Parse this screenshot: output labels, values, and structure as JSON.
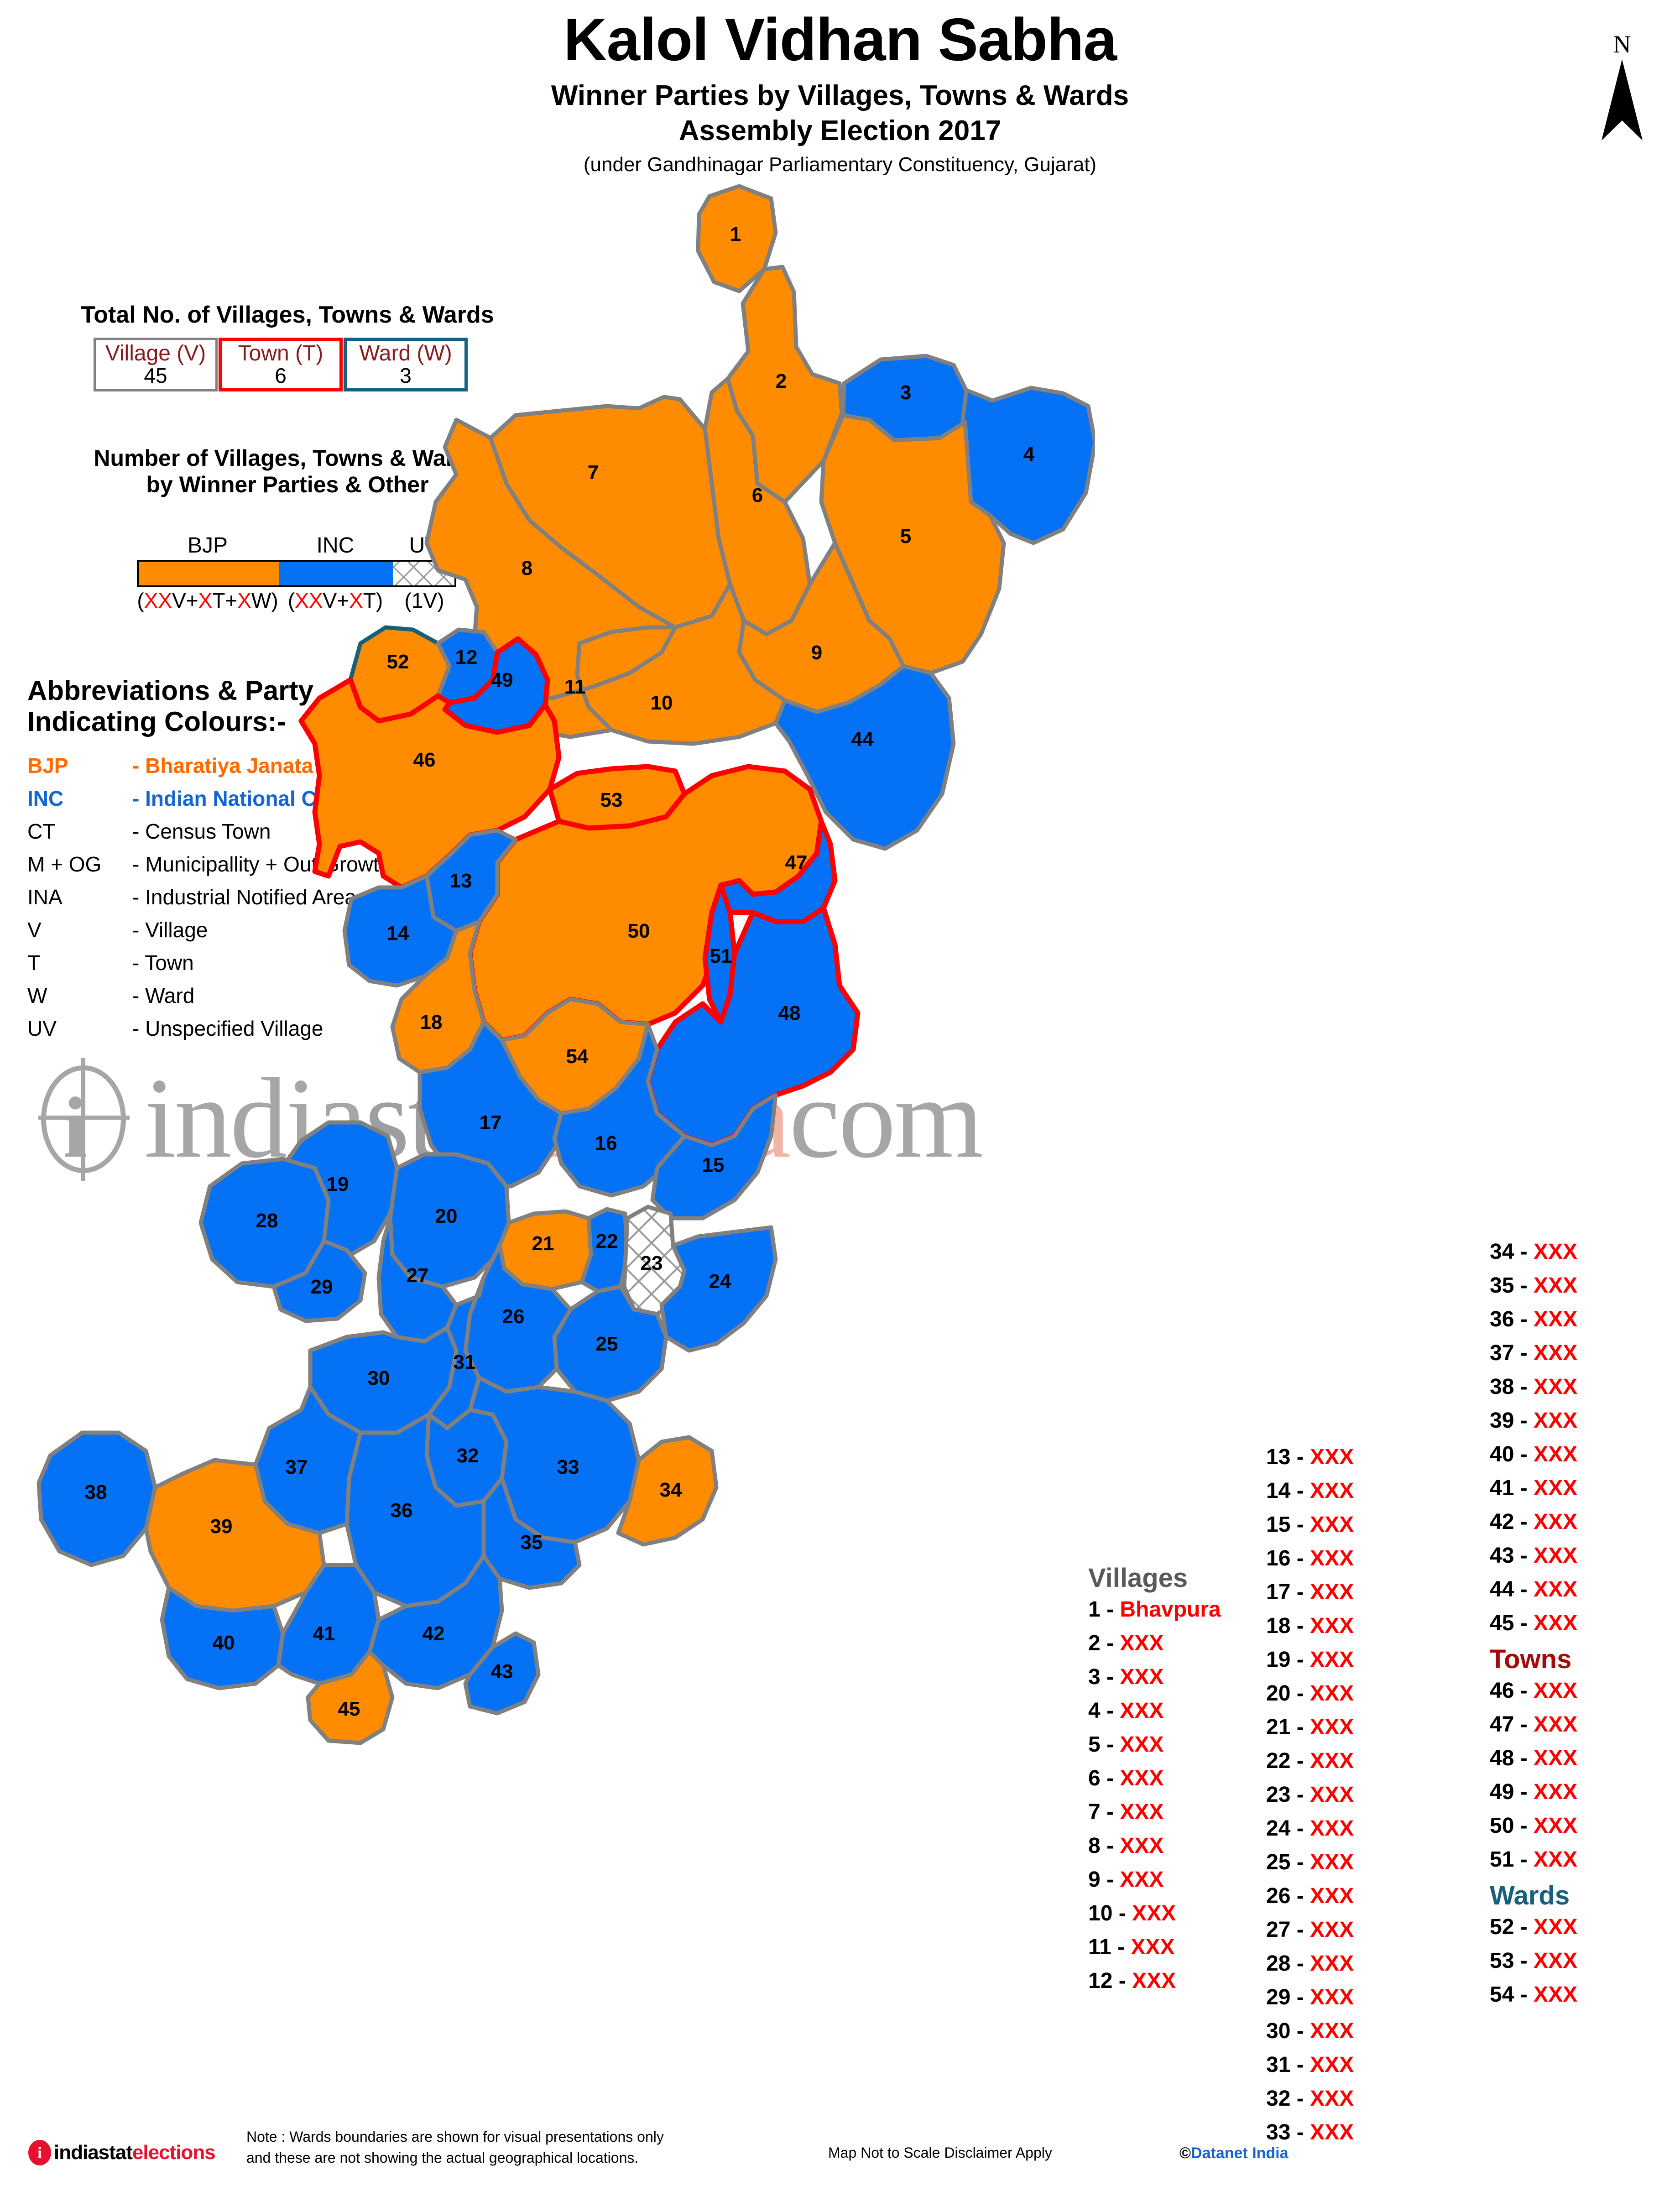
{
  "title": {
    "main": "Kalol Vidhan Sabha",
    "sub1": "Winner Parties by Villages, Towns & Wards",
    "sub2": "Assembly Election 2017",
    "sub3": "(under Gandhinagar Parliamentary Constituency, Gujarat)"
  },
  "north": {
    "label": "N"
  },
  "totals": {
    "heading": "Total No. of Villages, Towns & Wards",
    "boxes": [
      {
        "label": "Village (V)",
        "value": "45",
        "border": "#808080"
      },
      {
        "label": "Town (T)",
        "value": "6",
        "border": "#FF0000"
      },
      {
        "label": "Ward (W)",
        "value": "3",
        "border": "#16607E"
      }
    ]
  },
  "counts": {
    "heading_line1": "Number of Villages, Towns & Wards",
    "heading_line2": "by Winner Parties & Other",
    "parties": [
      {
        "name": "BJP",
        "color": "#FF8C00",
        "count_parts": [
          "XX",
          "V+",
          "X",
          "T+",
          "X",
          "W"
        ],
        "count_text": "(XXV+XT+XW)"
      },
      {
        "name": "INC",
        "color": "#0571F5",
        "count_parts": [
          "XX",
          "V+",
          "X",
          "T"
        ],
        "count_text": "(XXV+XT)"
      },
      {
        "name": "UV",
        "color": "#FFFFFF",
        "count_parts": [],
        "count_text": "(1V)"
      }
    ]
  },
  "abbreviations": {
    "heading_line1": "Abbreviations & Party",
    "heading_line2": "Indicating Colours:-",
    "rows": [
      {
        "key": "BJP",
        "value": "- Bharatiya Janata Party",
        "style": "bjp"
      },
      {
        "key": "INC",
        "value": "- Indian National Congress",
        "style": "inc"
      },
      {
        "key": "CT",
        "value": "- Census Town",
        "style": "plain"
      },
      {
        "key": "M + OG",
        "value": "- Municipallity + Out Growth",
        "style": "plain"
      },
      {
        "key": "INA",
        "value": "- Industrial Notified Area",
        "style": "plain"
      },
      {
        "key": "V",
        "value": "- Village",
        "style": "plain"
      },
      {
        "key": "T",
        "value": "- Town",
        "style": "plain"
      },
      {
        "key": "W",
        "value": "- Ward",
        "style": "plain"
      },
      {
        "key": "UV",
        "value": "- Unspecified Village",
        "style": "plain"
      }
    ]
  },
  "watermark": {
    "part1": "india",
    "part2": "stat",
    "part3": "media",
    "part4": "com"
  },
  "lists": {
    "villages_heading": "Villages",
    "towns_heading": "Towns",
    "wards_heading": "Wards",
    "villages": [
      {
        "num": "1",
        "name": "Bhavpura"
      },
      {
        "num": "2",
        "name": "XXX"
      },
      {
        "num": "3",
        "name": "XXX"
      },
      {
        "num": "4",
        "name": "XXX"
      },
      {
        "num": "5",
        "name": "XXX"
      },
      {
        "num": "6",
        "name": "XXX"
      },
      {
        "num": "7",
        "name": "XXX"
      },
      {
        "num": "8",
        "name": "XXX"
      },
      {
        "num": "9",
        "name": "XXX"
      },
      {
        "num": "10",
        "name": "XXX"
      },
      {
        "num": "11",
        "name": "XXX"
      },
      {
        "num": "12",
        "name": "XXX"
      },
      {
        "num": "13",
        "name": "XXX"
      },
      {
        "num": "14",
        "name": "XXX"
      },
      {
        "num": "15",
        "name": "XXX"
      },
      {
        "num": "16",
        "name": "XXX"
      },
      {
        "num": "17",
        "name": "XXX"
      },
      {
        "num": "18",
        "name": "XXX"
      },
      {
        "num": "19",
        "name": "XXX"
      },
      {
        "num": "20",
        "name": "XXX"
      },
      {
        "num": "21",
        "name": "XXX"
      },
      {
        "num": "22",
        "name": "XXX"
      },
      {
        "num": "23",
        "name": "XXX"
      },
      {
        "num": "24",
        "name": "XXX"
      },
      {
        "num": "25",
        "name": "XXX"
      },
      {
        "num": "26",
        "name": "XXX"
      },
      {
        "num": "27",
        "name": "XXX"
      },
      {
        "num": "28",
        "name": "XXX"
      },
      {
        "num": "29",
        "name": "XXX"
      },
      {
        "num": "30",
        "name": "XXX"
      },
      {
        "num": "31",
        "name": "XXX"
      },
      {
        "num": "32",
        "name": "XXX"
      },
      {
        "num": "33",
        "name": "XXX"
      },
      {
        "num": "34",
        "name": "XXX"
      },
      {
        "num": "35",
        "name": "XXX"
      },
      {
        "num": "36",
        "name": "XXX"
      },
      {
        "num": "37",
        "name": "XXX"
      },
      {
        "num": "38",
        "name": "XXX"
      },
      {
        "num": "39",
        "name": "XXX"
      },
      {
        "num": "40",
        "name": "XXX"
      },
      {
        "num": "41",
        "name": "XXX"
      },
      {
        "num": "42",
        "name": "XXX"
      },
      {
        "num": "43",
        "name": "XXX"
      },
      {
        "num": "44",
        "name": "XXX"
      },
      {
        "num": "45",
        "name": "XXX"
      }
    ],
    "towns": [
      {
        "num": "46",
        "name": "XXX"
      },
      {
        "num": "47",
        "name": "XXX"
      },
      {
        "num": "48",
        "name": "XXX"
      },
      {
        "num": "49",
        "name": "XXX"
      },
      {
        "num": "50",
        "name": "XXX"
      },
      {
        "num": "51",
        "name": "XXX"
      }
    ],
    "wards": [
      {
        "num": "52",
        "name": "XXX"
      },
      {
        "num": "53",
        "name": "XXX"
      },
      {
        "num": "54",
        "name": "XXX"
      }
    ]
  },
  "footer": {
    "logo_part1": "indiastat",
    "logo_part2": "elections",
    "logo_mark": "i",
    "note_line1": "Note : Wards  boundaries are shown for visual presentations only",
    "note_line2": "and these are not showing the actual geographical locations.",
    "scale": "Map Not to Scale   Disclaimer Apply",
    "copyright_symbol": "©",
    "copyright_text": "Datanet India"
  },
  "map": {
    "colors": {
      "bjp": "#FF8C00",
      "inc": "#0571F5",
      "uv": "#FFFFFF",
      "village_border": "#808080",
      "town_border": "#FF0000",
      "ward_border": "#16607E"
    },
    "regions": [
      {
        "id": "1",
        "party": "bjp",
        "type": "village"
      },
      {
        "id": "2",
        "party": "bjp",
        "type": "village"
      },
      {
        "id": "3",
        "party": "inc",
        "type": "village"
      },
      {
        "id": "4",
        "party": "inc",
        "type": "village"
      },
      {
        "id": "5",
        "party": "bjp",
        "type": "village"
      },
      {
        "id": "6",
        "party": "bjp",
        "type": "village"
      },
      {
        "id": "7",
        "party": "bjp",
        "type": "village"
      },
      {
        "id": "8",
        "party": "bjp",
        "type": "village"
      },
      {
        "id": "9",
        "party": "bjp",
        "type": "village"
      },
      {
        "id": "10",
        "party": "bjp",
        "type": "village"
      },
      {
        "id": "11",
        "party": "bjp",
        "type": "village"
      },
      {
        "id": "12",
        "party": "inc",
        "type": "village"
      },
      {
        "id": "13",
        "party": "inc",
        "type": "village"
      },
      {
        "id": "14",
        "party": "inc",
        "type": "village"
      },
      {
        "id": "15",
        "party": "inc",
        "type": "village"
      },
      {
        "id": "16",
        "party": "inc",
        "type": "village"
      },
      {
        "id": "17",
        "party": "inc",
        "type": "village"
      },
      {
        "id": "18",
        "party": "bjp",
        "type": "village"
      },
      {
        "id": "19",
        "party": "inc",
        "type": "village"
      },
      {
        "id": "20",
        "party": "inc",
        "type": "village"
      },
      {
        "id": "21",
        "party": "bjp",
        "type": "village"
      },
      {
        "id": "22",
        "party": "inc",
        "type": "village"
      },
      {
        "id": "23",
        "party": "uv",
        "type": "village"
      },
      {
        "id": "24",
        "party": "inc",
        "type": "village"
      },
      {
        "id": "25",
        "party": "inc",
        "type": "village"
      },
      {
        "id": "26",
        "party": "inc",
        "type": "village"
      },
      {
        "id": "27",
        "party": "inc",
        "type": "village"
      },
      {
        "id": "28",
        "party": "inc",
        "type": "village"
      },
      {
        "id": "29",
        "party": "inc",
        "type": "village"
      },
      {
        "id": "30",
        "party": "inc",
        "type": "village"
      },
      {
        "id": "31",
        "party": "inc",
        "type": "village"
      },
      {
        "id": "32",
        "party": "inc",
        "type": "village"
      },
      {
        "id": "33",
        "party": "inc",
        "type": "village"
      },
      {
        "id": "34",
        "party": "bjp",
        "type": "village"
      },
      {
        "id": "35",
        "party": "inc",
        "type": "village"
      },
      {
        "id": "36",
        "party": "inc",
        "type": "village"
      },
      {
        "id": "37",
        "party": "inc",
        "type": "village"
      },
      {
        "id": "38",
        "party": "inc",
        "type": "village"
      },
      {
        "id": "39",
        "party": "bjp",
        "type": "village"
      },
      {
        "id": "40",
        "party": "inc",
        "type": "village"
      },
      {
        "id": "41",
        "party": "inc",
        "type": "village"
      },
      {
        "id": "42",
        "party": "inc",
        "type": "village"
      },
      {
        "id": "43",
        "party": "inc",
        "type": "village"
      },
      {
        "id": "44",
        "party": "inc",
        "type": "village"
      },
      {
        "id": "45",
        "party": "bjp",
        "type": "village"
      },
      {
        "id": "46",
        "party": "bjp",
        "type": "town"
      },
      {
        "id": "47",
        "party": "inc",
        "type": "town"
      },
      {
        "id": "48",
        "party": "inc",
        "type": "town"
      },
      {
        "id": "49",
        "party": "inc",
        "type": "town"
      },
      {
        "id": "50",
        "party": "bjp",
        "type": "town"
      },
      {
        "id": "51",
        "party": "inc",
        "type": "town"
      },
      {
        "id": "52",
        "party": "bjp",
        "type": "ward"
      },
      {
        "id": "53",
        "party": "bjp",
        "type": "ward"
      },
      {
        "id": "54",
        "party": "bjp",
        "type": "ward"
      }
    ]
  }
}
